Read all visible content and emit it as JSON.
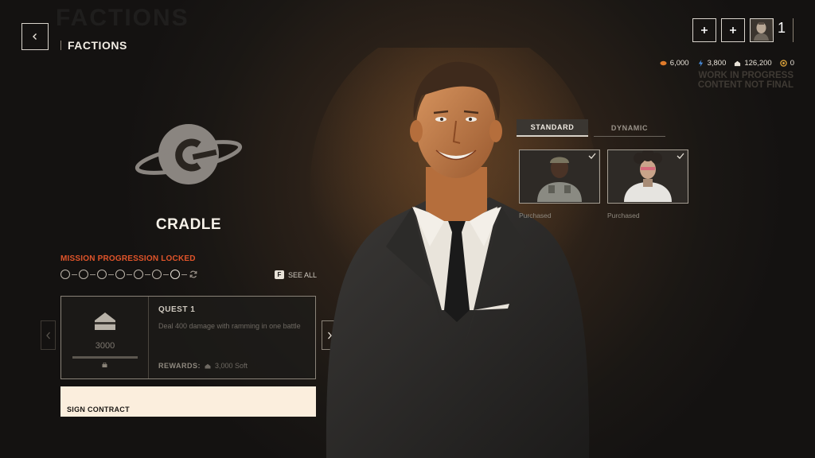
{
  "header": {
    "ghost_text": "FACTIONS",
    "title": "FACTIONS",
    "level": "1"
  },
  "currencies": [
    {
      "icon": "orange-coin-icon",
      "value": "6,000",
      "color": "#e07b2a"
    },
    {
      "icon": "blue-bolt-icon",
      "value": "3,800",
      "color": "#4a8fe0"
    },
    {
      "icon": "cash-stack-icon",
      "value": "126,200",
      "color": "#e8e2d8"
    },
    {
      "icon": "gold-token-icon",
      "value": "0",
      "color": "#d9a03a"
    }
  ],
  "watermark": {
    "line1": "WORK IN PROGRESS",
    "line2": "CONTENT NOT FINAL"
  },
  "faction": {
    "name": "CRADLE",
    "emblem": "planet-ring-emblem",
    "emblem_color": "#8a8580"
  },
  "mission": {
    "status": "MISSION PROGRESSION LOCKED",
    "status_color": "#e0542a",
    "total_nodes": 7,
    "see_all_key": "F",
    "see_all_label": "SEE ALL"
  },
  "quest": {
    "title": "QUEST 1",
    "description": "Deal 400 damage with ramming in one battle",
    "amount": "3000",
    "rewards_label": "REWARDS:",
    "rewards_value": "3,000 Soft"
  },
  "sign_contract": {
    "label": "SIGN CONTRACT",
    "bg_color": "#fbeedd"
  },
  "skins": {
    "tabs": [
      {
        "label": "STANDARD",
        "active": true
      },
      {
        "label": "DYNAMIC",
        "active": false
      }
    ],
    "items": [
      {
        "status": "Purchased",
        "checked": true
      },
      {
        "status": "Purchased",
        "checked": true
      }
    ]
  }
}
